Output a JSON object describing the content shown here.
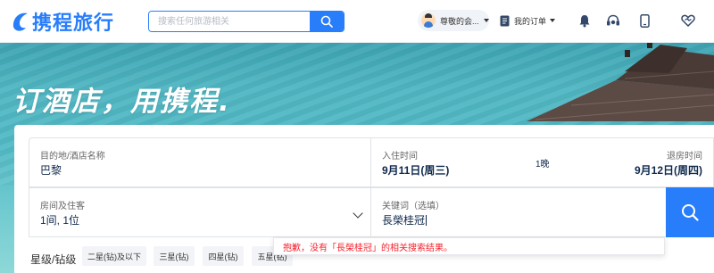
{
  "header": {
    "logo_text": "携程旅行",
    "search": {
      "placeholder": "搜索任何旅游相关"
    },
    "user": {
      "name": "尊敬的会..."
    },
    "orders_label": "我的订单",
    "icons": [
      "bell-icon",
      "headset-icon",
      "mobile-icon",
      "heart-handshake-icon"
    ]
  },
  "banner": {
    "slogan": "订酒店，用携程."
  },
  "search_form": {
    "destination": {
      "label": "目的地/酒店名称",
      "value": "巴黎"
    },
    "checkin": {
      "label": "入住时间",
      "value": "9月11日(周三)"
    },
    "nights": "1晚",
    "checkout": {
      "label": "退房时间",
      "value": "9月12日(周四)"
    },
    "rooms": {
      "label": "房间及住客",
      "value": "1间, 1位"
    },
    "keyword": {
      "label": "关键词（选填）",
      "value": "長榮桂冠"
    }
  },
  "star_filter": {
    "label": "星级/钻级",
    "options": [
      "二星(钻)及以下",
      "三星(钻)",
      "四星(钻)",
      "五星(钻)"
    ]
  },
  "error_tip": "抱歉，没有「長榮桂冠」的相关搜索结果。",
  "colors": {
    "accent": "#287dfa",
    "error": "#f5222d",
    "text_dark": "#0f294d"
  }
}
